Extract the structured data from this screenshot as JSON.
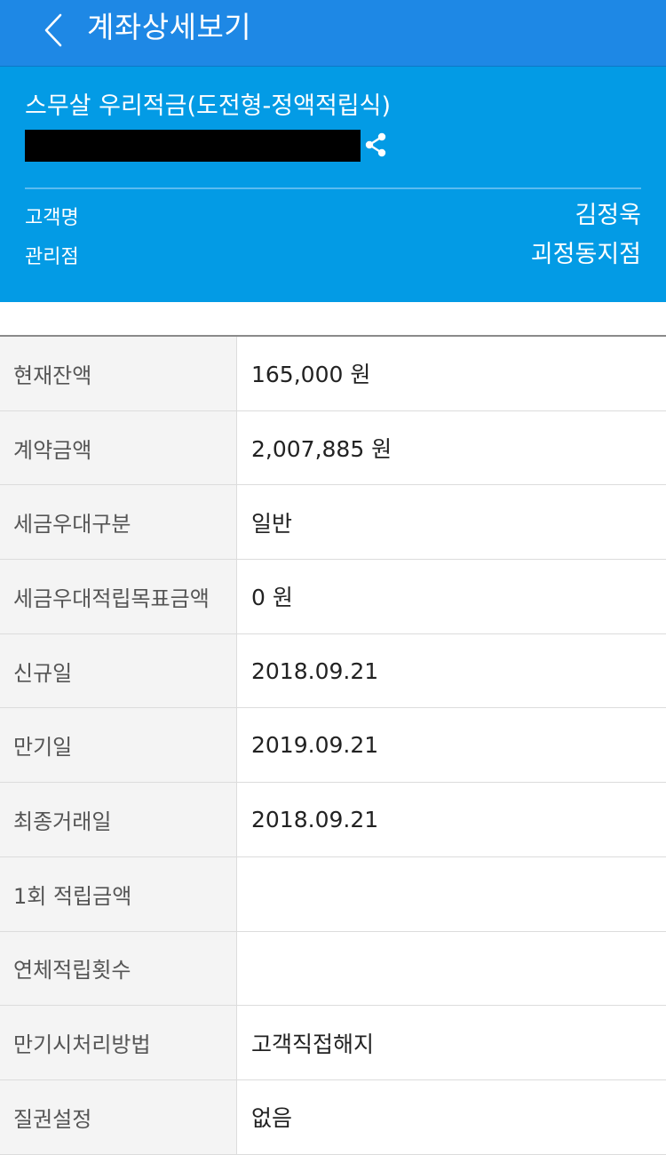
{
  "header": {
    "title": "계좌상세보기"
  },
  "summary": {
    "product_name": "스무살 우리적금(도전형-정액적립식)",
    "customer_label": "고객명",
    "customer_name": "김정욱",
    "branch_label": "관리점",
    "branch_name": "괴정동지점"
  },
  "details": [
    {
      "label": "현재잔액",
      "value": "165,000 원"
    },
    {
      "label": "계약금액",
      "value": "2,007,885 원"
    },
    {
      "label": "세금우대구분",
      "value": "일반"
    },
    {
      "label": "세금우대적립목표금액",
      "value": "0 원"
    },
    {
      "label": "신규일",
      "value": "2018.09.21"
    },
    {
      "label": "만기일",
      "value": "2019.09.21"
    },
    {
      "label": "최종거래일",
      "value": "2018.09.21"
    },
    {
      "label": "1회 적립금액",
      "value": ""
    },
    {
      "label": "연체적립횟수",
      "value": ""
    },
    {
      "label": "만기시처리방법",
      "value": "고객직접해지"
    },
    {
      "label": "질권설정",
      "value": "없음"
    }
  ],
  "colors": {
    "header_bg": "#1e88e5",
    "summary_bg": "#039be5",
    "key_cell_bg": "#f4f4f4"
  },
  "icons": {
    "back": "chevron-left-icon",
    "share": "share-icon"
  }
}
